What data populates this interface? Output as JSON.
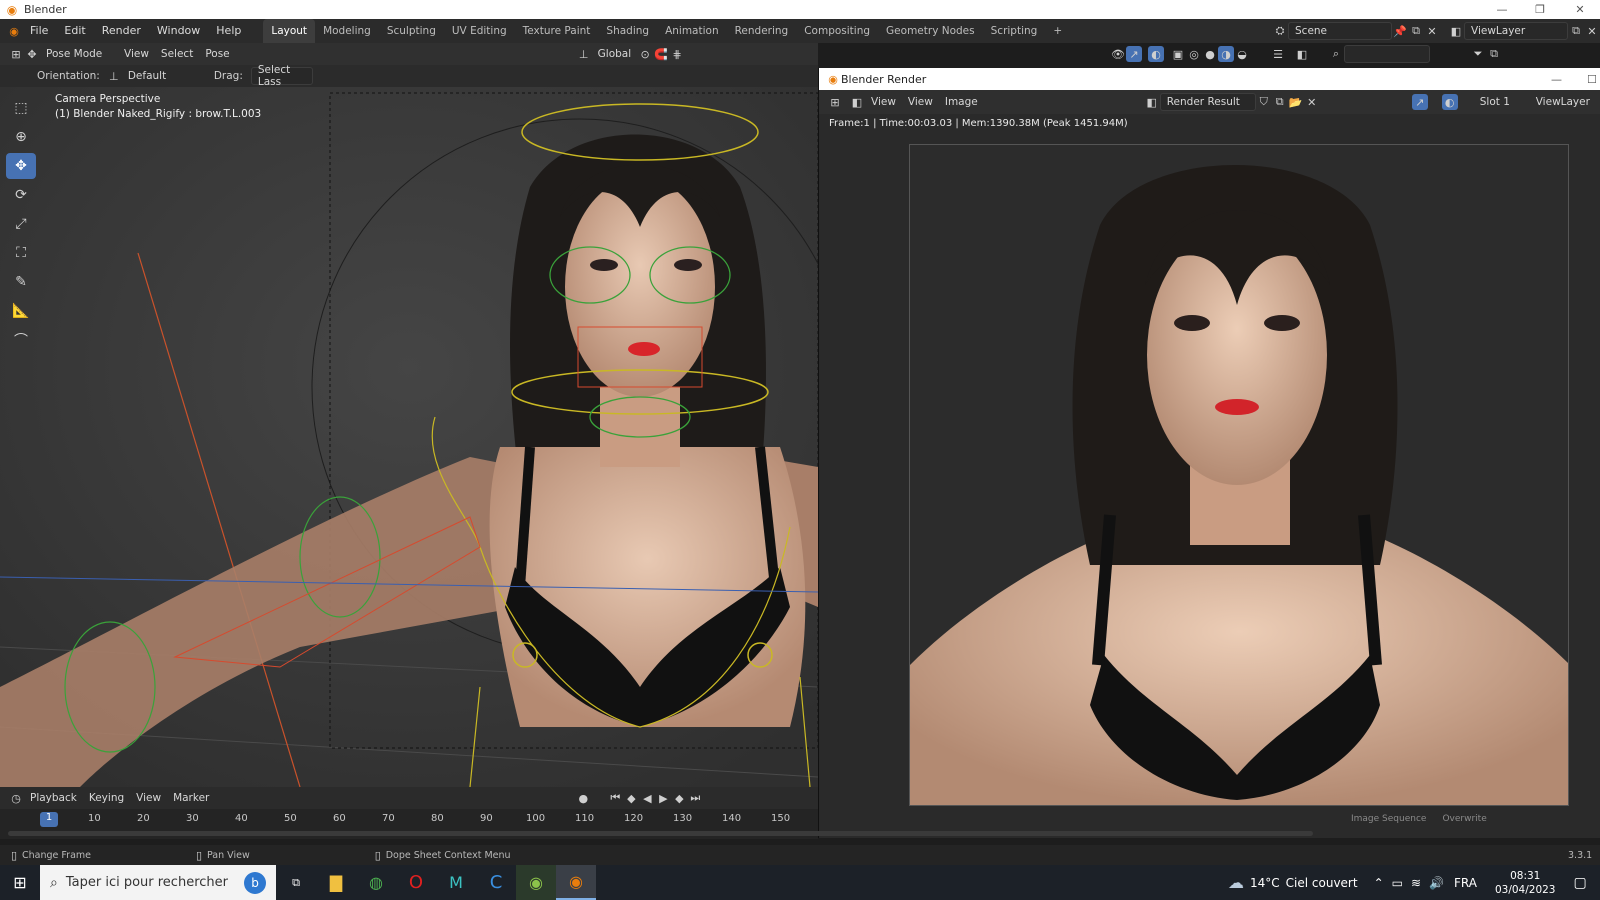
{
  "app": {
    "title": "Blender"
  },
  "menu": {
    "items": [
      "File",
      "Edit",
      "Render",
      "Window",
      "Help"
    ]
  },
  "workspaces": {
    "tabs": [
      "Layout",
      "Modeling",
      "Sculpting",
      "UV Editing",
      "Texture Paint",
      "Shading",
      "Animation",
      "Rendering",
      "Compositing",
      "Geometry Nodes",
      "Scripting"
    ],
    "add": "+"
  },
  "scene": {
    "name": "Scene",
    "view_layer": "ViewLayer"
  },
  "header": {
    "mode": "Pose Mode",
    "view": "View",
    "select": "Select",
    "pose": "Pose",
    "transform": "Global"
  },
  "toolsettings": {
    "orientation_label": "Orientation:",
    "orientation_value": "Default",
    "drag_label": "Drag:",
    "drag_value": "Select Lass"
  },
  "viewport": {
    "perspective": "Camera Perspective",
    "object": "(1) Blender Naked_Rigify : brow.T.L.003"
  },
  "render_window": {
    "title": "Blender Render",
    "view": "View",
    "view2": "View",
    "image": "Image",
    "result": "Render Result",
    "slot": "Slot 1",
    "view_layer": "ViewLayer",
    "stats": "Frame:1 | Time:00:03.03 | Mem:1390.38M (Peak 1451.94M)",
    "bottom_left": "Image Sequence",
    "bottom_right": "Overwrite"
  },
  "timeline": {
    "playback": "Playback",
    "keying": "Keying",
    "view": "View",
    "marker": "Marker",
    "current_frame": "1",
    "ticks": [
      "10",
      "20",
      "30",
      "40",
      "50",
      "60",
      "70",
      "80",
      "90",
      "100",
      "110",
      "120",
      "130",
      "140",
      "150"
    ]
  },
  "status": {
    "left": "Change Frame",
    "middle": "Pan View",
    "right": "Dope Sheet Context Menu",
    "version": "3.3.1"
  },
  "taskbar": {
    "search_placeholder": "Taper ici pour rechercher",
    "weather_temp": "14°C",
    "weather_desc": "Ciel couvert",
    "language": "FRA",
    "time": "08:31",
    "date": "03/04/2023"
  },
  "colors": {
    "accent": "#4772b3",
    "blender_orange": "#e87d0d",
    "bone_yellow": "#c9b824",
    "bone_green": "#3aa23a",
    "bone_red": "#d64a2e"
  }
}
